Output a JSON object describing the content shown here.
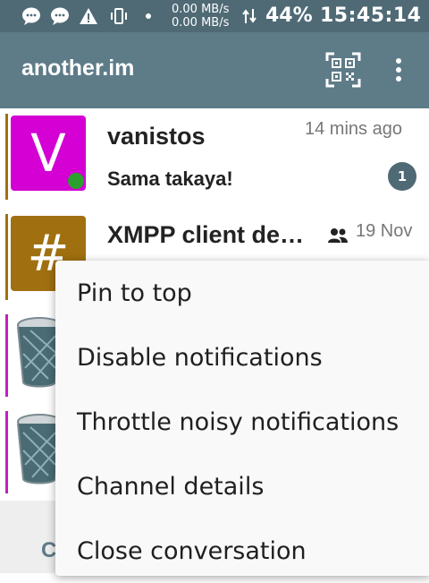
{
  "status_bar": {
    "icons": [
      "chat-bubble-icon",
      "chat-bubble-icon",
      "warning-icon",
      "vibrate-icon",
      "dot-icon",
      "data-transfer-icon"
    ],
    "net_up": "0.00 MB/s",
    "net_down": "0.00 MB/s",
    "battery": "44%",
    "time": "15:45:14"
  },
  "app_bar": {
    "title": "another.im",
    "actions": [
      "qr-code-icon",
      "more-vert-icon"
    ]
  },
  "conversations": [
    {
      "initial": "V",
      "name": "vanistos",
      "time": "14 mins ago",
      "message": "Sama takaya!",
      "unread": "1",
      "avatar_color": "#d400d4",
      "accent_color": "#a07010",
      "online_color": "#2ca02c"
    },
    {
      "initial": "#",
      "name": "XMPP client de…",
      "time": "19 Nov",
      "group_icon": "group-icon",
      "avatar_color": "#a07010",
      "accent_color": "#a07010"
    },
    {
      "avatar_icon": "trash-bin-icon",
      "accent_color": "#c020c0"
    },
    {
      "avatar_icon": "trash-bin-icon",
      "accent_color": "#c020c0"
    }
  ],
  "bottom_bar": {
    "label": "C"
  },
  "context_menu": {
    "items": [
      "Pin to top",
      "Disable notifications",
      "Throttle noisy notifications",
      "Channel details",
      "Close conversation"
    ]
  },
  "colors": {
    "statusbar": "#4f6a75",
    "appbar": "#5e7b88"
  }
}
